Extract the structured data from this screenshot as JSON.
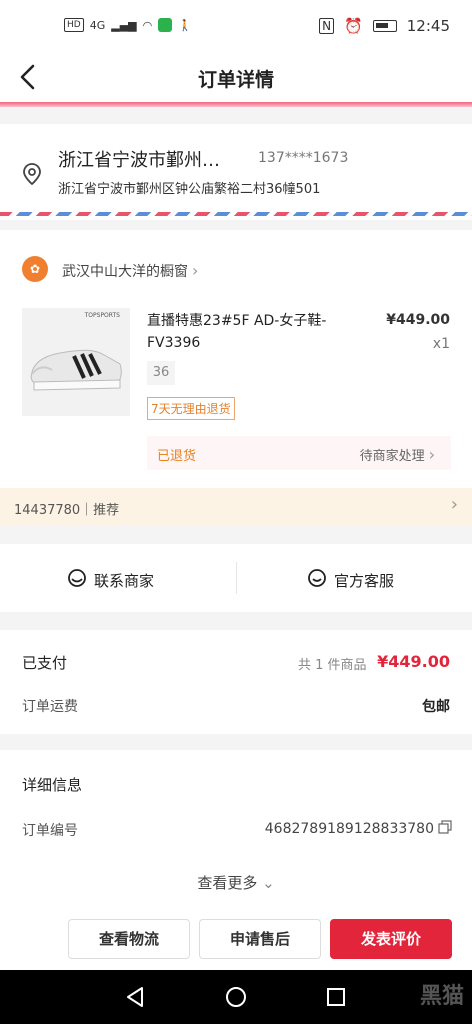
{
  "status_bar": {
    "hd": "HD",
    "network": "4G",
    "time": "12:45"
  },
  "nav": {
    "title": "订单详情"
  },
  "address": {
    "name": "浙江省宁波市鄞州…",
    "phone": "137****1673",
    "detail": "浙江省宁波市鄞州区钟公庙繁裕二村36幢501"
  },
  "shop": {
    "name": "武汉中山大洋的橱窗"
  },
  "product": {
    "brand_mark": "TOPSPORTS",
    "title": "直播特惠23#5F AD-女子鞋-FV3396",
    "price": "¥449.00",
    "quantity": "x1",
    "size": "36",
    "tag": "7天无理由退货"
  },
  "refund": {
    "status": "已退货",
    "action": "待商家处理"
  },
  "recommend_bar": {
    "text": "14437780｜推荐"
  },
  "contact": {
    "merchant": "联系商家",
    "service": "官方客服"
  },
  "payment": {
    "status": "已支付",
    "count": "共 1 件商品",
    "total": "¥449.00",
    "shipping_label": "订单运费",
    "shipping_value": "包邮"
  },
  "details": {
    "title": "详细信息",
    "order_label": "订单编号",
    "order_number": "4682789189128833780",
    "more": "查看更多"
  },
  "actions": {
    "logistics": "查看物流",
    "after_sale": "申请售后",
    "review": "发表评价"
  },
  "watermark": "黑猫",
  "colors": {
    "accent": "#e3253b",
    "refund": "#e8821f",
    "tag": "#e3822d"
  }
}
